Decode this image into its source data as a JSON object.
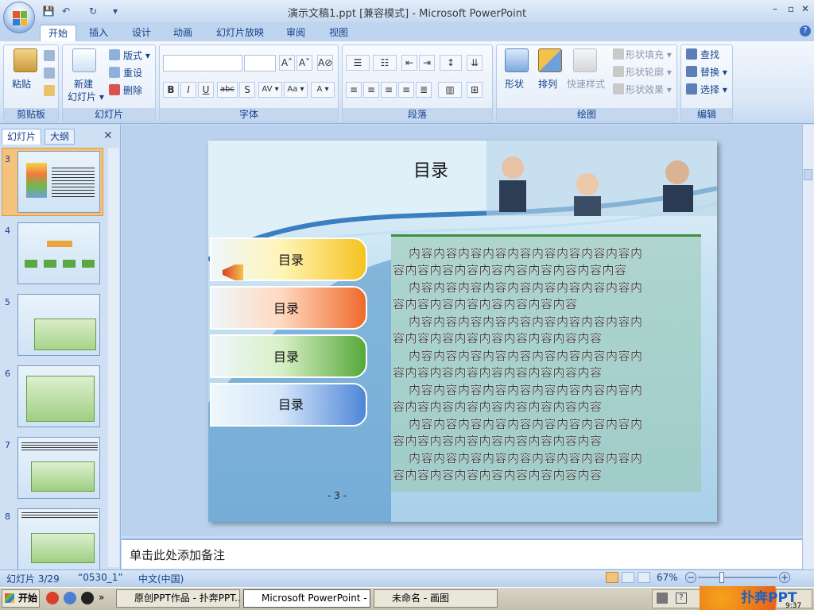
{
  "window": {
    "title": "演示文稿1.ppt [兼容模式] - Microsoft PowerPoint",
    "minimize": "–",
    "restore": "▫",
    "close": "✕"
  },
  "qat": {
    "save": "💾",
    "undo": "↶",
    "redo": "↻",
    "more": "▾"
  },
  "tabs": [
    "开始",
    "插入",
    "设计",
    "动画",
    "幻灯片放映",
    "审阅",
    "视图"
  ],
  "ribbon": {
    "clipboard": {
      "group": "剪贴板",
      "paste": "粘贴"
    },
    "slides": {
      "group": "幻灯片",
      "new_slide": "新建",
      "new_slide2": "幻灯片 ▾",
      "layout": "版式 ▾",
      "reset": "重设",
      "delete": "删除"
    },
    "font": {
      "group": "字体",
      "bold": "B",
      "italic": "I",
      "underline": "U",
      "strike": "abc",
      "shadow": "S",
      "spacing": "AV ▾",
      "case": "Aa ▾",
      "color": "A ▾",
      "grow": "A˄",
      "shrink": "A˅",
      "clear": "A⊘"
    },
    "paragraph": {
      "group": "段落"
    },
    "drawing": {
      "group": "绘图",
      "shapes": "形状",
      "arrange": "排列",
      "quick_styles": "快速样式",
      "fill": "形状填充 ▾",
      "outline": "形状轮廓 ▾",
      "effects": "形状效果 ▾"
    },
    "editing": {
      "group": "编辑",
      "find": "查找",
      "replace": "替换 ▾",
      "select": "选择 ▾"
    }
  },
  "panel": {
    "tab_slides": "幻灯片",
    "tab_outline": "大纲",
    "close": "✕",
    "thumbs": [
      "3",
      "4",
      "5",
      "6",
      "7",
      "8"
    ]
  },
  "slide": {
    "title": "目录",
    "menu": [
      "目录",
      "目录",
      "目录",
      "目录"
    ],
    "content": [
      "内容内容内容内容内容内容内容内容内容内",
      "容内容内容内容内容内容内容内容内容内容",
      "内容内容内容内容内容内容内容内容内容内",
      "容内容内容内容内容内容内容内容",
      "内容内容内容内容内容内容内容内容内容内",
      "容内容内容内容内容内容内容内容内容",
      "内容内容内容内容内容内容内容内容内容内",
      "容内容内容内容内容内容内容内容内容",
      "内容内容内容内容内容内容内容内容内容内",
      "容内容内容内容内容内容内容内容内容",
      "内容内容内容内容内容内容内容内容内容内",
      "容内容内容内容内容内容内容内容内容",
      "内容内容内容内容内容内容内容内容内容内",
      "容内容内容内容内容内容内容内容内容"
    ],
    "page_number": "- 3 -"
  },
  "notes": {
    "placeholder": "单击此处添加备注"
  },
  "status": {
    "slide_info": "幻灯片 3/29",
    "theme": "“0530_1”",
    "language": "中文(中国)",
    "zoom": "67%",
    "zoom_minus": "−",
    "zoom_plus": "+"
  },
  "taskbar": {
    "start": "开始",
    "items": [
      "原创PPT作品 - 扑奔PPT...",
      "Microsoft PowerPoint - [...",
      "未命名 - 画图"
    ],
    "clock": "9:37",
    "watermark": "扑奔PPT"
  },
  "colors": {
    "accent": "#15428b",
    "ribbon": "#dbe7f7",
    "selection": "#f3c27c"
  }
}
